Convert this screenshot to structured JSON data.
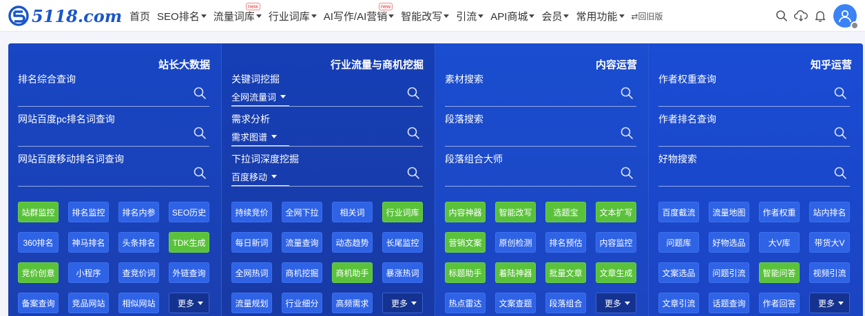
{
  "brand": {
    "logo_text": "5118.com"
  },
  "nav": [
    {
      "label": "首页",
      "caret": false,
      "badge": ""
    },
    {
      "label": "SEO排名",
      "caret": true,
      "badge": ""
    },
    {
      "label": "流量词库",
      "caret": true,
      "badge": "new"
    },
    {
      "label": "行业词库",
      "caret": true,
      "badge": ""
    },
    {
      "label": "AI写作/AI营销",
      "caret": true,
      "badge": "new"
    },
    {
      "label": "智能改写",
      "caret": true,
      "badge": ""
    },
    {
      "label": "引流",
      "caret": true,
      "badge": ""
    },
    {
      "label": "API商城",
      "caret": true,
      "badge": ""
    },
    {
      "label": "会员",
      "caret": true,
      "badge": ""
    },
    {
      "label": "常用功能",
      "caret": true,
      "badge": ""
    }
  ],
  "nav_switch": "⇄回旧版",
  "tools": [
    "search-icon",
    "cloud-download-icon",
    "bell-icon",
    "user-avatar-icon"
  ],
  "columns": [
    {
      "title": "站长大数据",
      "fields": [
        {
          "label": "排名综合查询",
          "select": ""
        },
        {
          "label": "网站百度pc排名词查询",
          "select": ""
        },
        {
          "label": "网站百度移动排名词查询",
          "select": ""
        }
      ],
      "buttons": [
        {
          "label": "站群监控",
          "green": true
        },
        {
          "label": "排名监控",
          "green": false
        },
        {
          "label": "排名内参",
          "green": false
        },
        {
          "label": "SEO历史",
          "green": false
        },
        {
          "label": "360排名",
          "green": false
        },
        {
          "label": "神马排名",
          "green": false
        },
        {
          "label": "头条排名",
          "green": false
        },
        {
          "label": "TDK生成",
          "green": true
        },
        {
          "label": "竞价创意",
          "green": true
        },
        {
          "label": "小程序",
          "green": false
        },
        {
          "label": "查竞价词",
          "green": false
        },
        {
          "label": "外链查询",
          "green": false
        },
        {
          "label": "备案查询",
          "green": false
        },
        {
          "label": "竞品网站",
          "green": false
        },
        {
          "label": "相似网站",
          "green": false
        }
      ],
      "more": "更多"
    },
    {
      "title": "行业流量与商机挖掘",
      "fields": [
        {
          "label": "关键词挖掘",
          "select": "全网流量词"
        },
        {
          "label": "需求分析",
          "select": "需求图谱"
        },
        {
          "label": "下拉词深度挖掘",
          "select": "百度移动"
        }
      ],
      "buttons": [
        {
          "label": "持续竞价",
          "green": false
        },
        {
          "label": "全网下拉",
          "green": false
        },
        {
          "label": "相关词",
          "green": false
        },
        {
          "label": "行业词库",
          "green": true
        },
        {
          "label": "每日新词",
          "green": false
        },
        {
          "label": "流量查询",
          "green": false
        },
        {
          "label": "动态趋势",
          "green": false
        },
        {
          "label": "长尾监控",
          "green": false
        },
        {
          "label": "全网热词",
          "green": false
        },
        {
          "label": "商机挖掘",
          "green": false
        },
        {
          "label": "商机助手",
          "green": true
        },
        {
          "label": "暴涨热词",
          "green": false
        },
        {
          "label": "流量规划",
          "green": false
        },
        {
          "label": "行业细分",
          "green": false
        },
        {
          "label": "高频需求",
          "green": false
        }
      ],
      "more": "更多"
    },
    {
      "title": "内容运营",
      "fields": [
        {
          "label": "素材搜索",
          "select": ""
        },
        {
          "label": "段落搜索",
          "select": ""
        },
        {
          "label": "段落组合大师",
          "select": ""
        }
      ],
      "buttons": [
        {
          "label": "内容神器",
          "green": true
        },
        {
          "label": "智能改写",
          "green": true
        },
        {
          "label": "选题宝",
          "green": true
        },
        {
          "label": "文本扩写",
          "green": true
        },
        {
          "label": "营销文案",
          "green": true
        },
        {
          "label": "原创检测",
          "green": false
        },
        {
          "label": "排名预估",
          "green": false
        },
        {
          "label": "内容监控",
          "green": false
        },
        {
          "label": "标题助手",
          "green": true
        },
        {
          "label": "着陆神器",
          "green": true
        },
        {
          "label": "批量文章",
          "green": true
        },
        {
          "label": "文章生成",
          "green": true
        },
        {
          "label": "热点雷达",
          "green": false
        },
        {
          "label": "文案查题",
          "green": false
        },
        {
          "label": "段落组合",
          "green": false
        }
      ],
      "more": "更多"
    },
    {
      "title": "知乎运营",
      "fields": [
        {
          "label": "作者权重查询",
          "select": ""
        },
        {
          "label": "作者排名查询",
          "select": ""
        },
        {
          "label": "好物搜索",
          "select": ""
        }
      ],
      "buttons": [
        {
          "label": "百度截流",
          "green": false
        },
        {
          "label": "流量地图",
          "green": false
        },
        {
          "label": "作者权重",
          "green": false
        },
        {
          "label": "站内排名",
          "green": false
        },
        {
          "label": "问题库",
          "green": false
        },
        {
          "label": "好物选品",
          "green": false
        },
        {
          "label": "大V库",
          "green": false
        },
        {
          "label": "带货大V",
          "green": false
        },
        {
          "label": "文案选品",
          "green": false
        },
        {
          "label": "问题引流",
          "green": false
        },
        {
          "label": "智能问答",
          "green": true
        },
        {
          "label": "视频引流",
          "green": false
        },
        {
          "label": "文章引流",
          "green": false
        },
        {
          "label": "话题查询",
          "green": false
        },
        {
          "label": "作者回答",
          "green": false
        }
      ],
      "more": "更多"
    }
  ]
}
